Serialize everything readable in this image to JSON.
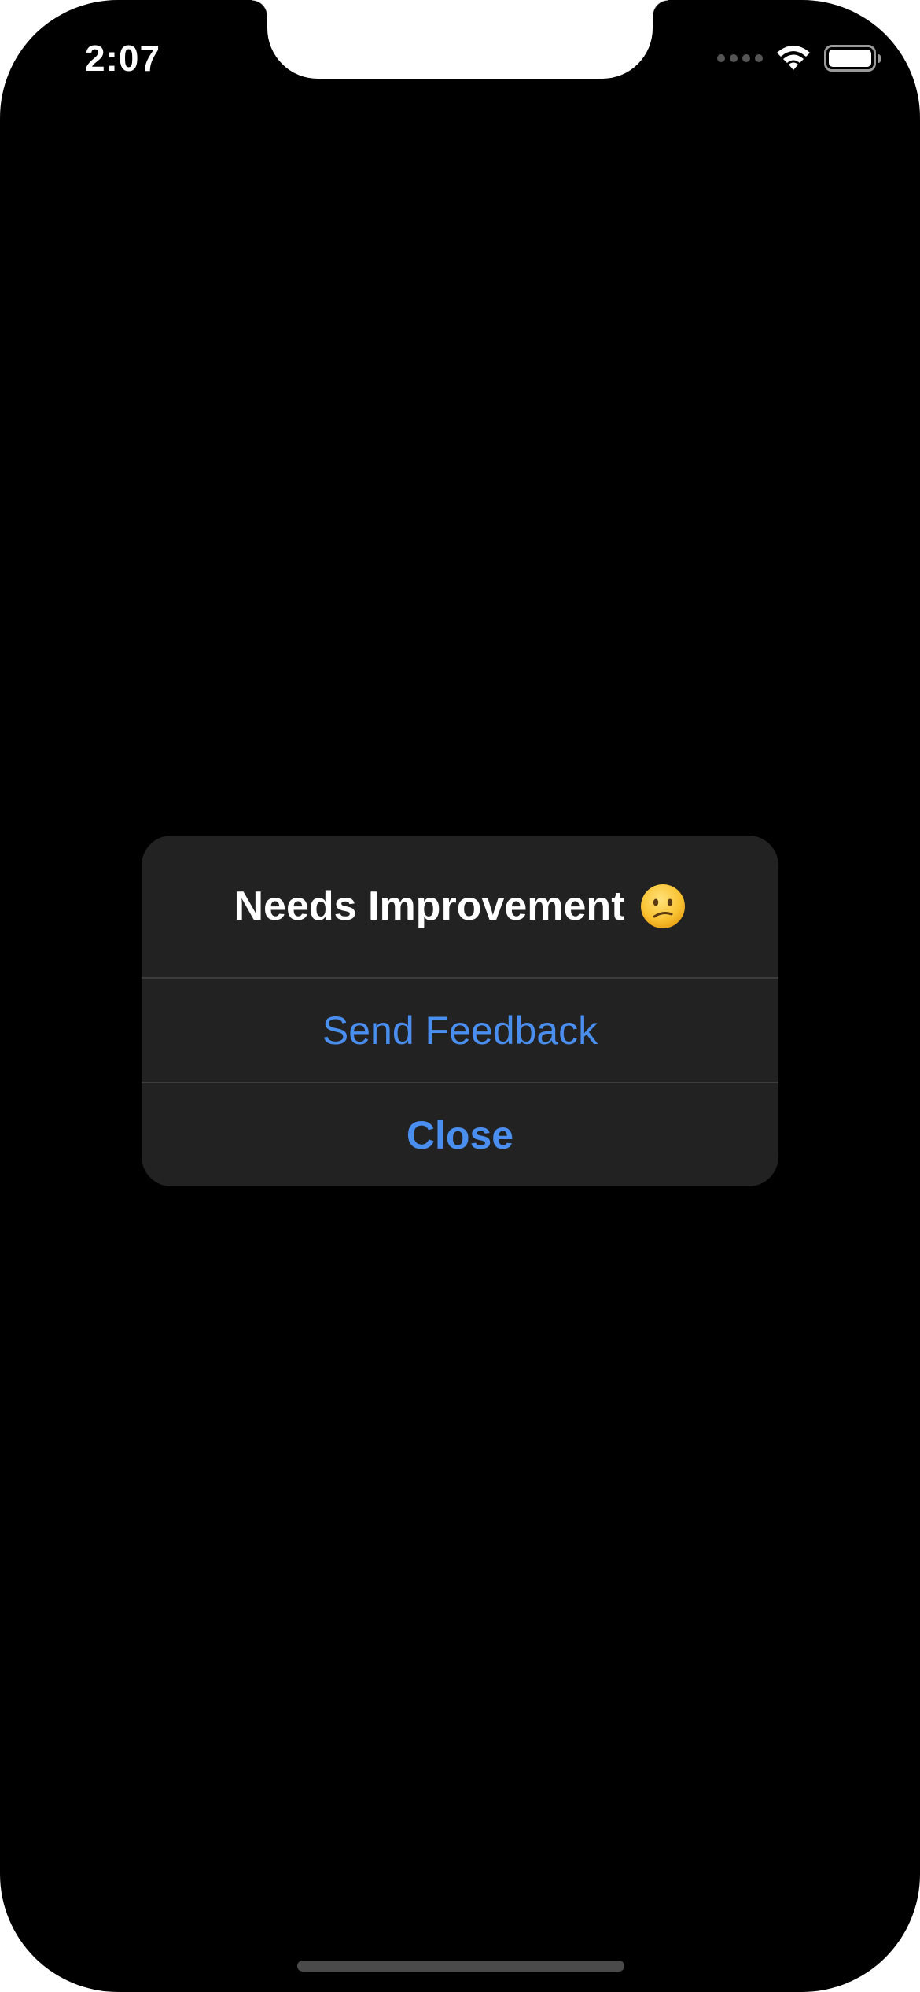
{
  "status_bar": {
    "time": "2:07",
    "icons": [
      "cellular-signal-icon",
      "wifi-icon",
      "battery-icon"
    ]
  },
  "alert": {
    "title": "Needs Improvement",
    "emoji_icon": "confused-face-icon",
    "primary_action": "Send Feedback",
    "secondary_action": "Close"
  },
  "colors": {
    "background": "#000000",
    "alert_background": "#222222",
    "action_blue": "#4a8ff0",
    "divider": "#3d3d3f"
  }
}
